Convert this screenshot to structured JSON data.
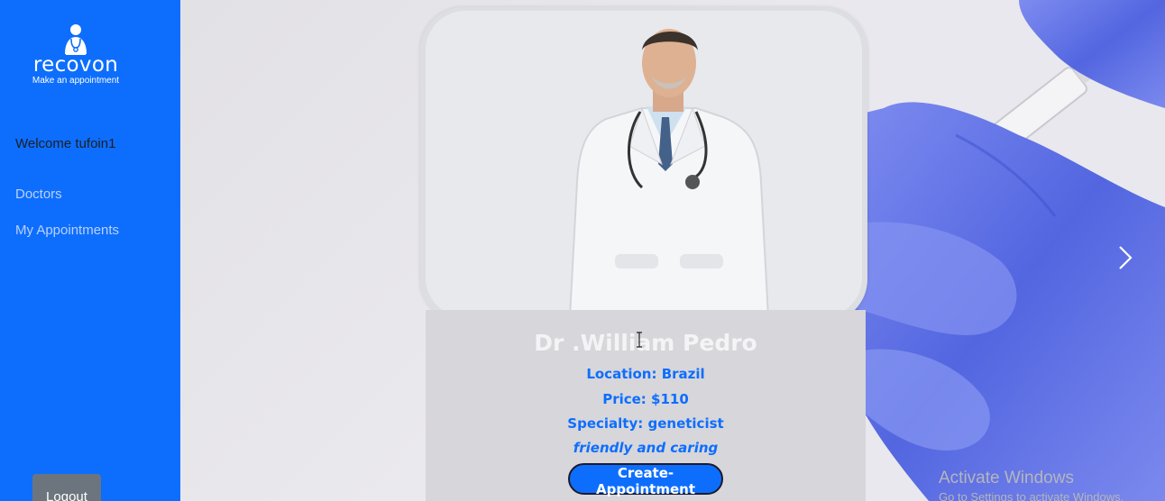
{
  "brand": {
    "name": "recovon",
    "tagline": "Make an appointment",
    "logo_icon": "doctor-icon"
  },
  "sidebar": {
    "welcome": "Welcome tufoin1",
    "items": [
      {
        "label": "Doctors"
      },
      {
        "label": "My Appointments"
      }
    ],
    "logout_label": "Logout"
  },
  "doctor": {
    "name": "Dr .William Pedro",
    "location": "Location: Brazil",
    "price": "Price: $110",
    "specialty": "Specialty: geneticist",
    "description": "friendly and caring",
    "cta_label": "Create-Appointment"
  },
  "carousel": {
    "next_icon": "chevron-right-icon"
  },
  "watermark": {
    "title": "Activate Windows",
    "subtitle": "Go to Settings to activate Windows."
  },
  "colors": {
    "primary": "#0d6efd",
    "sidebar_nav": "#b9d1ff",
    "logout_bg": "#6c757d",
    "glove": "#5b6ee6"
  }
}
